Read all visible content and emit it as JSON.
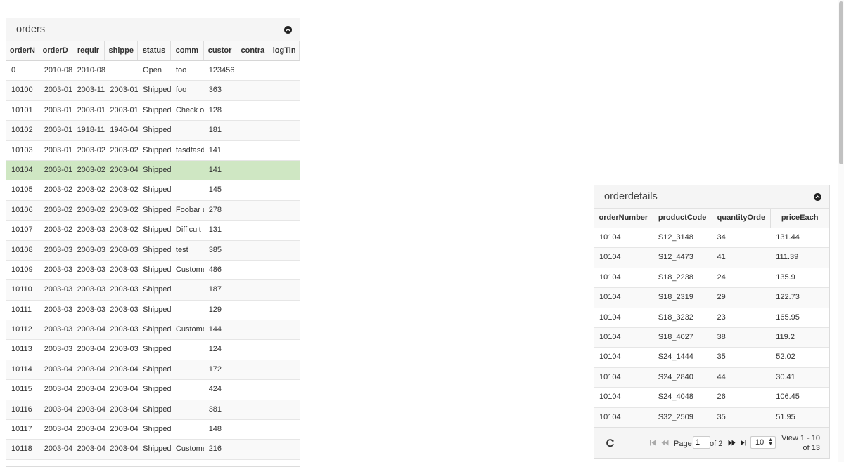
{
  "orders": {
    "title": "orders",
    "columns": [
      "orderN",
      "orderD",
      "requir",
      "shippe",
      "status",
      "comm",
      "custor",
      "contra",
      "logTin"
    ],
    "rows": [
      [
        "0",
        "2010-08-",
        "2010-08-",
        "",
        "Open",
        "foo",
        "123456",
        "",
        ""
      ],
      [
        "10100",
        "2003-01-",
        "2003-11-",
        "2003-01-",
        "Shipped",
        "foo",
        "363",
        "",
        ""
      ],
      [
        "10101",
        "2003-01-",
        "2003-01-",
        "2003-01-",
        "Shipped",
        "Check or",
        "128",
        "",
        ""
      ],
      [
        "10102",
        "2003-01-",
        "1918-11-",
        "1946-04-",
        "Shipped",
        "",
        "181",
        "",
        ""
      ],
      [
        "10103",
        "2003-01-",
        "2003-02-",
        "2003-02-",
        "Shipped",
        "fasdfasd",
        "141",
        "",
        ""
      ],
      [
        "10104",
        "2003-01-",
        "2003-02-",
        "2003-04-",
        "Shipped",
        "",
        "141",
        "",
        ""
      ],
      [
        "10105",
        "2003-02-",
        "2003-02-",
        "2003-02-",
        "Shipped",
        "",
        "145",
        "",
        ""
      ],
      [
        "10106",
        "2003-02-",
        "2003-02-",
        "2003-02-",
        "Shipped",
        "Foobar u",
        "278",
        "",
        ""
      ],
      [
        "10107",
        "2003-02-",
        "2003-03-",
        "2003-02-",
        "Shipped",
        "Difficult",
        "131",
        "",
        ""
      ],
      [
        "10108",
        "2003-03-",
        "2003-03-",
        "2008-03-",
        "Shipped",
        "test",
        "385",
        "",
        ""
      ],
      [
        "10109",
        "2003-03-",
        "2003-03-",
        "2003-03-",
        "Shipped",
        "Custome",
        "486",
        "",
        ""
      ],
      [
        "10110",
        "2003-03-",
        "2003-03-",
        "2003-03-",
        "Shipped",
        "",
        "187",
        "",
        ""
      ],
      [
        "10111",
        "2003-03-",
        "2003-03-",
        "2003-03-",
        "Shipped",
        "",
        "129",
        "",
        ""
      ],
      [
        "10112",
        "2003-03-",
        "2003-04-",
        "2003-03-",
        "Shipped",
        "Custome",
        "144",
        "",
        ""
      ],
      [
        "10113",
        "2003-03-",
        "2003-04-",
        "2003-03-",
        "Shipped",
        "",
        "124",
        "",
        ""
      ],
      [
        "10114",
        "2003-04-",
        "2003-04-",
        "2003-04-",
        "Shipped",
        "",
        "172",
        "",
        ""
      ],
      [
        "10115",
        "2003-04-",
        "2003-04-",
        "2003-04-",
        "Shipped",
        "",
        "424",
        "",
        ""
      ],
      [
        "10116",
        "2003-04-",
        "2003-04-",
        "2003-04-",
        "Shipped",
        "",
        "381",
        "",
        ""
      ],
      [
        "10117",
        "2003-04-",
        "2003-04-",
        "2003-04-",
        "Shipped",
        "",
        "148",
        "",
        ""
      ],
      [
        "10118",
        "2003-04-",
        "2003-04-",
        "2003-04-",
        "Shipped",
        "Custome",
        "216",
        "",
        ""
      ]
    ],
    "selected_row": 5,
    "collapse_icon": "circle-chevron-up-icon"
  },
  "orderdetails": {
    "title": "orderdetails",
    "columns": [
      "orderNumber",
      "productCode",
      "quantityOrde",
      "priceEach"
    ],
    "rows": [
      [
        "10104",
        "S12_3148",
        "34",
        "131.44"
      ],
      [
        "10104",
        "S12_4473",
        "41",
        "111.39"
      ],
      [
        "10104",
        "S18_2238",
        "24",
        "135.9"
      ],
      [
        "10104",
        "S18_2319",
        "29",
        "122.73"
      ],
      [
        "10104",
        "S18_3232",
        "23",
        "165.95"
      ],
      [
        "10104",
        "S18_4027",
        "38",
        "119.2"
      ],
      [
        "10104",
        "S24_1444",
        "35",
        "52.02"
      ],
      [
        "10104",
        "S24_2840",
        "44",
        "30.41"
      ],
      [
        "10104",
        "S24_4048",
        "26",
        "106.45"
      ],
      [
        "10104",
        "S32_2509",
        "35",
        "51.95"
      ]
    ],
    "pager": {
      "page_label": "Page",
      "page_value": "1",
      "of_label": "of 2",
      "rows_per_page": "10",
      "view_line1": "View 1 - 10",
      "view_line2": "of 13"
    }
  },
  "colors": {
    "selected_row": "#cfe7c3",
    "header_bg": "#f5f5f5"
  }
}
